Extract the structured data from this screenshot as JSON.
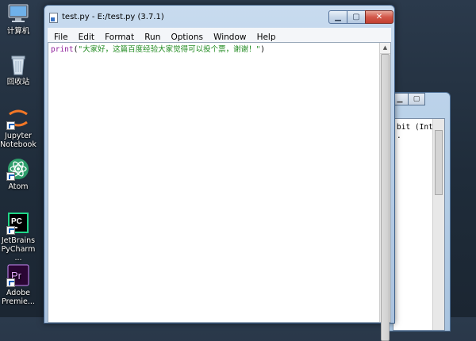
{
  "desktop": {
    "icons": [
      {
        "label": "计算机",
        "icon": "computer-icon"
      },
      {
        "label": "回收站",
        "icon": "recycle-bin-icon"
      },
      {
        "label": "Jupyter Notebook",
        "line1": "Jupyter",
        "line2": "Notebook",
        "icon": "jupyter-icon"
      },
      {
        "label": "Atom",
        "icon": "atom-icon"
      },
      {
        "label": "JetBrains PyCharm ...",
        "line1": "JetBrains",
        "line2": "PyCharm ...",
        "glyph": "PC",
        "icon": "pycharm-icon"
      },
      {
        "label": "Adobe Premie...",
        "line1": "Adobe",
        "line2": "Premie...",
        "glyph": "Pr",
        "icon": "premiere-icon"
      }
    ]
  },
  "editor_window": {
    "title": "test.py - E:/test.py (3.7.1)",
    "controls": {
      "minimize": "▁",
      "maximize": "▢",
      "close": "✕"
    },
    "menu": [
      "File",
      "Edit",
      "Format",
      "Run",
      "Options",
      "Window",
      "Help"
    ],
    "code": {
      "keyword": "print",
      "open": "(",
      "string": "\"大家好，这篇百度经验大家觉得可以投个票，谢谢！\"",
      "close": ")"
    }
  },
  "shell_window": {
    "text_line1": "bit (Inte",
    "text_line2": "."
  },
  "colors": {
    "keyword": "#8f1f9b",
    "string": "#1f8a1f",
    "close_button": "#c23f30"
  }
}
